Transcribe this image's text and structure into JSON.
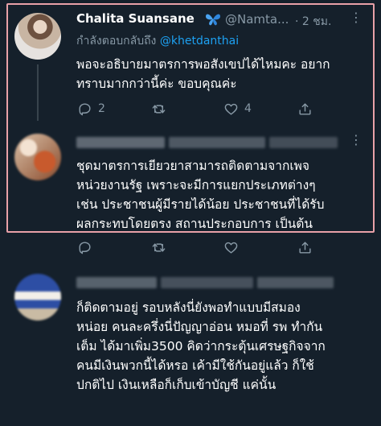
{
  "tweets": [
    {
      "name": "Chalita Suansane",
      "handle": "@Namta...",
      "time": "· 2 ชม.",
      "reply_prefix": "กำลังตอบกลับถึง",
      "reply_mention": "@khetdanthai",
      "text": "พอจะอธิบายมาตรการพอสังเขปได้ไหมคะ อยาก\nทราบมากกว่านี้ค่ะ ขอบคุณค่ะ",
      "replies": "2",
      "retweets": "",
      "likes": "4"
    },
    {
      "text": "ชุดมาตรการเยียวยาสามารถติดตามจากเพจ\nหน่วยงานรัฐ เพราะจะมีการแยกประเภทต่างๆ\nเช่น ประชาชนผู้มีรายได้น้อย ประชาชนที่ได้รับ\nผลกระทบโดยตรง สถานประกอบการ เป็นต้น"
    },
    {
      "text": "ก็ติดตามอยู่ รอบหลังนี่ยังพอทำแบบมีสมอง\nหน่อย คนละครึ่งนี่ปัญญาอ่อน หมอที่ รพ ทำกัน\nเต็ม ได้มาเพิ่ม3500 คิดว่ากระตุ้นเศรษฐกิจจาก\nคนมีเงินพวกนี้ได้หรอ เค้ามีใช้กันอยู่แล้ว ก็ใช้\nปกติไป เงินเหลือก็เก็บเข้าบัญชี แค่นั้น"
    }
  ],
  "icons": [
    "reply-icon",
    "retweet-icon",
    "like-icon",
    "share-icon",
    "verified-butterfly-icon",
    "more-icon"
  ],
  "colors": {
    "background": "#15202b",
    "text": "#ffffff",
    "muted": "#8899a6",
    "accent": "#1da1f2",
    "highlight_border": "#e8a0a8"
  }
}
